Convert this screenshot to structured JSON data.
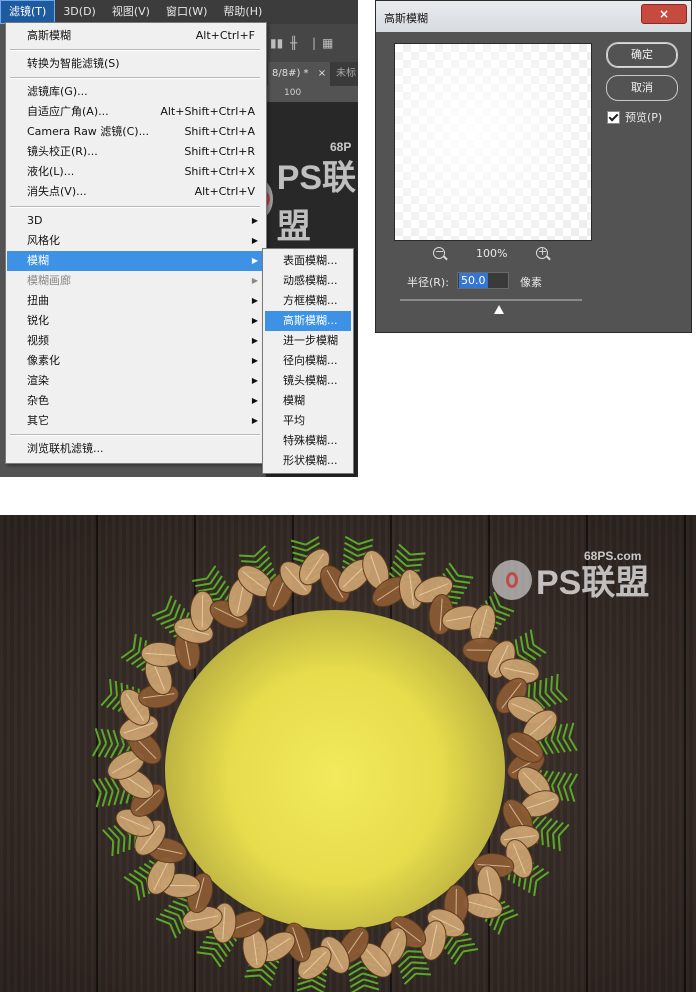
{
  "menubar": {
    "items": [
      "滤镜(T)",
      "3D(D)",
      "视图(V)",
      "窗口(W)",
      "帮助(H)"
    ],
    "active_index": 0
  },
  "document_tabs": {
    "tab1": "8/8#) *",
    "tab1_close": "×",
    "tab2": "未标"
  },
  "ruler": {
    "label": "100"
  },
  "filter_menu": {
    "last_filter": {
      "label": "高斯模糊",
      "shortcut": "Alt+Ctrl+F"
    },
    "convert_smart": {
      "label": "转换为智能滤镜(S)"
    },
    "filter_gallery": {
      "label": "滤镜库(G)..."
    },
    "adaptive_wide": {
      "label": "自适应广角(A)...",
      "shortcut": "Alt+Shift+Ctrl+A"
    },
    "camera_raw": {
      "label": "Camera Raw 滤镜(C)...",
      "shortcut": "Shift+Ctrl+A"
    },
    "lens_correction": {
      "label": "镜头校正(R)...",
      "shortcut": "Shift+Ctrl+R"
    },
    "liquify": {
      "label": "液化(L)...",
      "shortcut": "Shift+Ctrl+X"
    },
    "vanishing_point": {
      "label": "消失点(V)...",
      "shortcut": "Alt+Ctrl+V"
    },
    "submenus": [
      {
        "label": "3D",
        "state": "normal"
      },
      {
        "label": "风格化",
        "state": "normal"
      },
      {
        "label": "模糊",
        "state": "highlight"
      },
      {
        "label": "模糊画廊",
        "state": "disabled"
      },
      {
        "label": "扭曲",
        "state": "normal"
      },
      {
        "label": "锐化",
        "state": "normal"
      },
      {
        "label": "视频",
        "state": "normal"
      },
      {
        "label": "像素化",
        "state": "normal"
      },
      {
        "label": "渲染",
        "state": "normal"
      },
      {
        "label": "杂色",
        "state": "normal"
      },
      {
        "label": "其它",
        "state": "normal"
      }
    ],
    "browse_online": {
      "label": "浏览联机滤镜..."
    }
  },
  "blur_submenu": {
    "items": [
      "表面模糊...",
      "动感模糊...",
      "方框模糊...",
      "高斯模糊...",
      "进一步模糊",
      "径向模糊...",
      "镜头模糊...",
      "模糊",
      "平均",
      "特殊模糊...",
      "形状模糊..."
    ],
    "highlight_index": 3
  },
  "dialog": {
    "title": "高斯模糊",
    "close_symbol": "×",
    "ok_label": "确定",
    "cancel_label": "取消",
    "preview_label": "预览(P)",
    "preview_checked": true,
    "zoom_out_symbol": "−",
    "zoom_in_symbol": "+",
    "zoom_level": "100%",
    "radius_label": "半径(R):",
    "radius_value": "50.0",
    "radius_unit": "像素"
  },
  "watermark": {
    "domain": "68PS.com",
    "brand": "PS联盟",
    "partial_domain": "68P"
  },
  "colors": {
    "menu_highlight": "#3d92e6",
    "dialog_bg": "#535353",
    "close_button": "#c74a3f",
    "glow": "#f2ea5c",
    "leaf_gold": "#c9a070",
    "leaf_copper": "#8a5a34",
    "pine_green": "#5aa828"
  }
}
